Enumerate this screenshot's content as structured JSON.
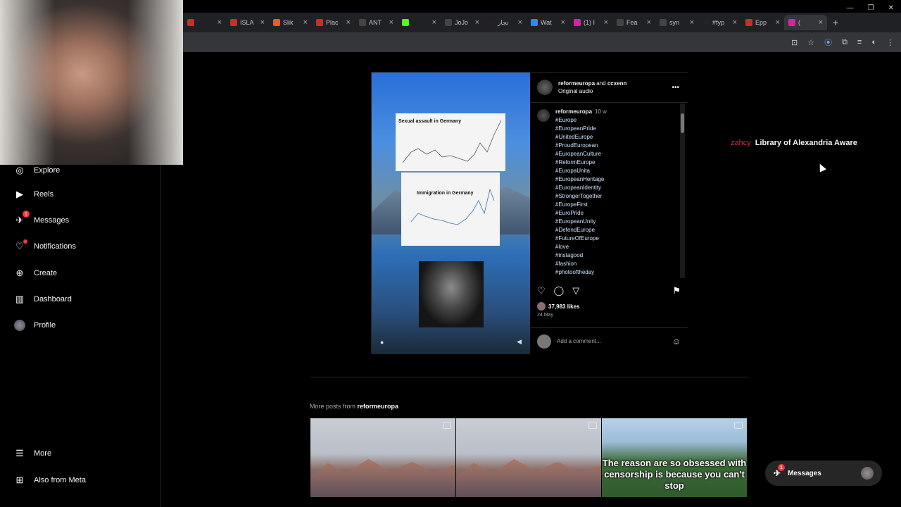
{
  "browser": {
    "tabs": [
      {
        "label": "",
        "color": "#c4302b"
      },
      {
        "label": "ISLA",
        "color": "#c4302b"
      },
      {
        "label": "Slik",
        "color": "#e55d2b"
      },
      {
        "label": "Plac",
        "color": "#c4302b"
      },
      {
        "label": "ANT",
        "color": "#444"
      },
      {
        "label": "",
        "color": "#53fc18"
      },
      {
        "label": "JoJo",
        "color": "#444"
      },
      {
        "label": "تجار",
        "color": "#222"
      },
      {
        "label": "Wat",
        "color": "#2a8bf2"
      },
      {
        "label": "(1) I",
        "color": "#d6249f"
      },
      {
        "label": "Fea",
        "color": "#444"
      },
      {
        "label": "syn",
        "color": "#444"
      },
      {
        "label": "#fyp",
        "color": "#222"
      },
      {
        "label": "Epp",
        "color": "#c4302b"
      },
      {
        "label": "(",
        "color": "#d6249f"
      }
    ],
    "new_tab": "+"
  },
  "sidebar": {
    "items": [
      {
        "label": "Explore",
        "icon": "◎"
      },
      {
        "label": "Reels",
        "icon": "▶"
      },
      {
        "label": "Messages",
        "icon": "✈",
        "badge": "1"
      },
      {
        "label": "Notifications",
        "icon": "♡"
      },
      {
        "label": "Create",
        "icon": "⊕"
      },
      {
        "label": "Dashboard",
        "icon": "▥"
      },
      {
        "label": "Profile",
        "icon": ""
      }
    ],
    "more": "More",
    "also": "Also from Meta"
  },
  "post": {
    "author": "reformeuropa",
    "and": "and",
    "coauthor": "ccxenn",
    "audio": "Original audio",
    "caption_user": "reformeuropa",
    "caption_time": "10 w",
    "hashtags": [
      "#Europe",
      "#EuropeanPride",
      "#UnitedEurope",
      "#ProudEuropean",
      "#EuropeanCulture",
      "#ReformEurope",
      "#EuropaUnita",
      "#EuropeanHeritage",
      "#EuropeanIdentity",
      "#StrongerTogether",
      "#EuropeFirst",
      "#EuroPride",
      "#EuropeanUnity",
      "#DefendEurope",
      "#FutureOfEurope",
      "#love",
      "#instagood",
      "#fashion",
      "#photooftheday"
    ],
    "likes": "37,983 likes",
    "date": "24 May",
    "comment_placeholder": "Add a comment...",
    "chart1_title": "Sexual assault in Germany",
    "chart2_title": "Immigration in Germany"
  },
  "overlay": {
    "user": "zahcy",
    "text": "Library of Alexandria Aware"
  },
  "more_posts": {
    "prefix": "More posts from",
    "user": "reformeuropa",
    "thumb3_text": "The reason  are so obsessed with censorship is because you can't stop"
  },
  "messages_box": {
    "label": "Messages",
    "badge": "1"
  }
}
